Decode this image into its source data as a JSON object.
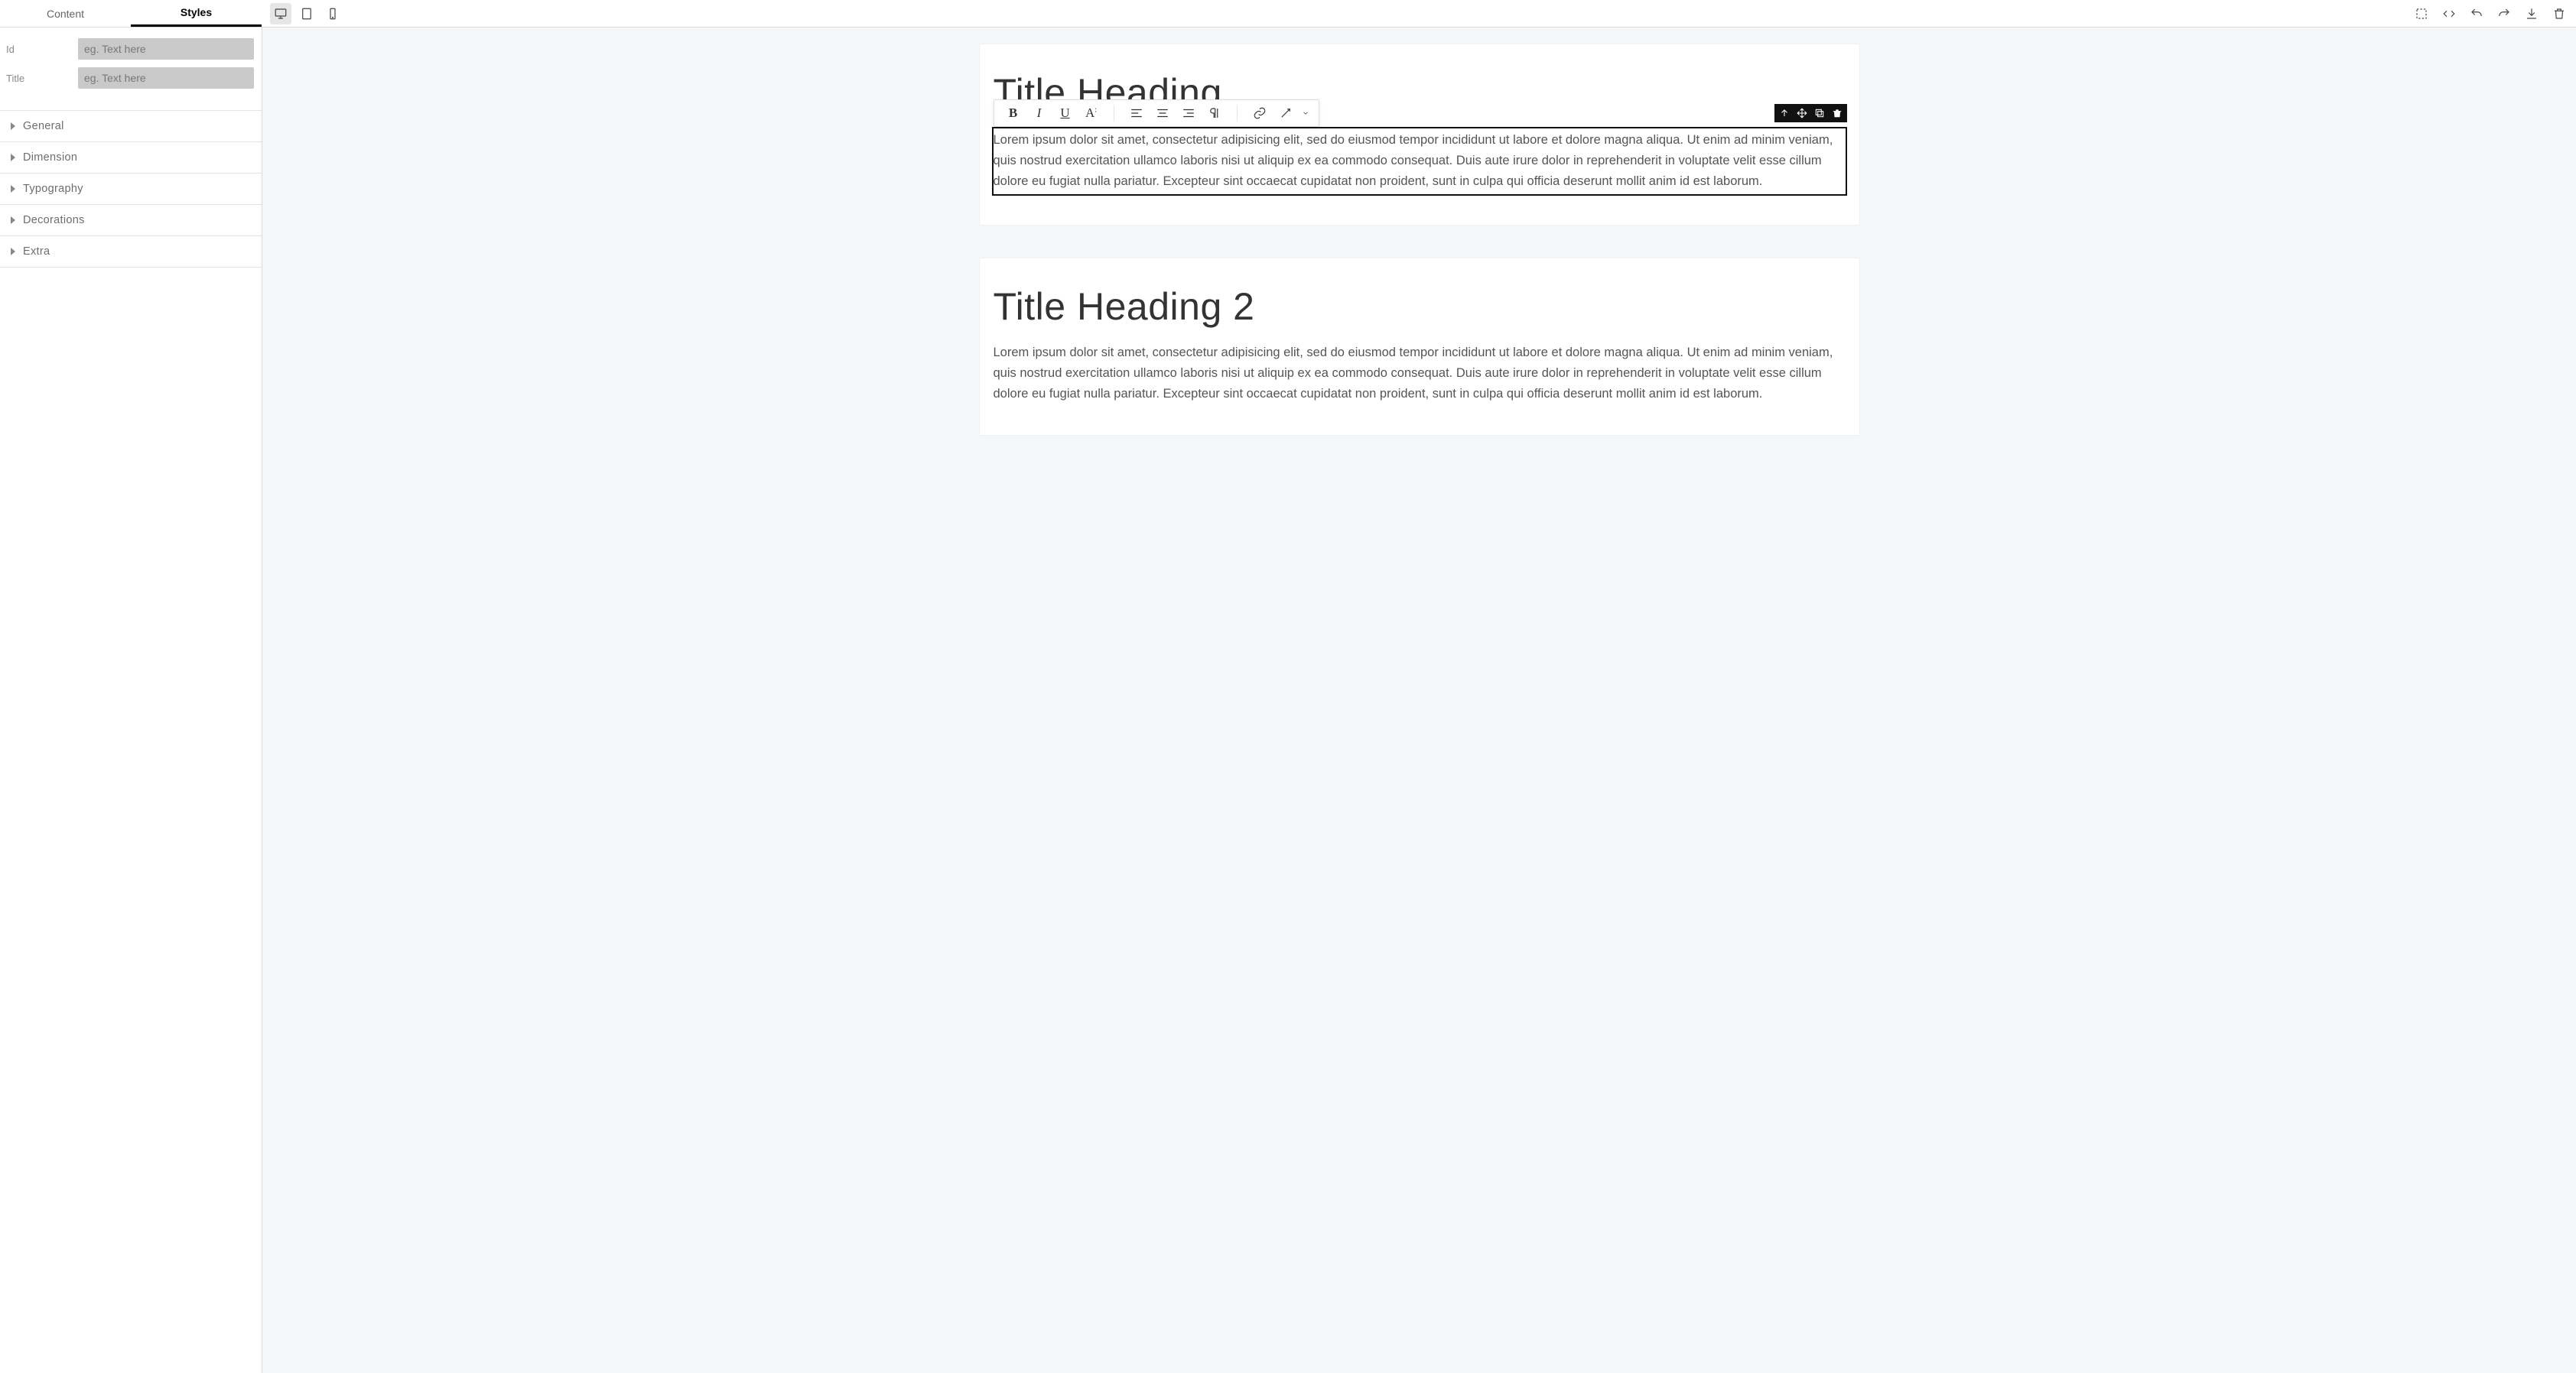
{
  "sidebar": {
    "tabs": {
      "content": "Content",
      "styles": "Styles"
    },
    "fields": {
      "id_label": "Id",
      "id_placeholder": "eg. Text here",
      "title_label": "Title",
      "title_placeholder": "eg. Text here"
    },
    "sections": {
      "general": "General",
      "dimension": "Dimension",
      "typography": "Typography",
      "decorations": "Decorations",
      "extra": "Extra"
    }
  },
  "topbar": {
    "devices": {
      "desktop": "desktop",
      "tablet": "tablet",
      "mobile": "mobile"
    },
    "actions": {
      "outline": "outline",
      "code": "code",
      "undo": "undo",
      "redo": "redo",
      "download": "download",
      "delete": "delete"
    }
  },
  "rte": {
    "bold": "B",
    "italic": "I",
    "underline": "U",
    "text_style": "A",
    "align_left": "align-left",
    "align_center": "align-center",
    "align_right": "align-right",
    "paragraph": "paragraph",
    "link": "link",
    "wand": "wand"
  },
  "selection_toolbar": {
    "parent": "select-parent",
    "move": "move",
    "copy": "copy",
    "delete": "delete"
  },
  "canvas": {
    "card1": {
      "title": "Title Heading",
      "body": "Lorem ipsum dolor sit amet, consectetur adipisicing elit, sed do eiusmod tempor incididunt ut labore et dolore magna aliqua. Ut enim ad minim veniam, quis nostrud exercitation ullamco laboris nisi ut aliquip ex ea commodo consequat. Duis aute irure dolor in reprehenderit in voluptate velit esse cillum dolore eu fugiat nulla pariatur. Excepteur sint occaecat cupidatat non proident, sunt in culpa qui officia deserunt mollit anim id est laborum."
    },
    "card2": {
      "title": "Title Heading 2",
      "body": "Lorem ipsum dolor sit amet, consectetur adipisicing elit, sed do eiusmod tempor incididunt ut labore et dolore magna aliqua. Ut enim ad minim veniam, quis nostrud exercitation ullamco laboris nisi ut aliquip ex ea commodo consequat. Duis aute irure dolor in reprehenderit in voluptate velit esse cillum dolore eu fugiat nulla pariatur. Excepteur sint occaecat cupidatat non proident, sunt in culpa qui officia deserunt mollit anim id est laborum."
    }
  }
}
